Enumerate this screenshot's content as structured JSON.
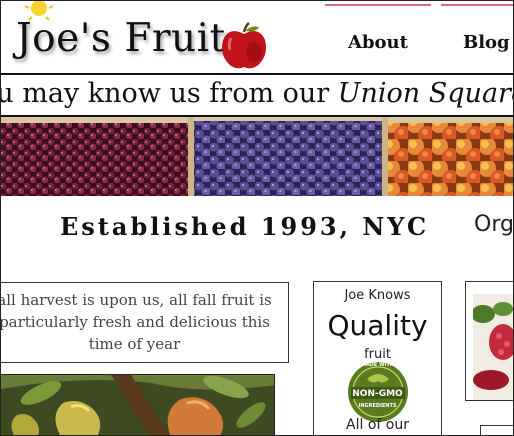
{
  "header": {
    "logo_text": "Joe's Fruit",
    "nav": [
      {
        "label": "About"
      },
      {
        "label": "Blog"
      }
    ]
  },
  "marquee": {
    "text_plain": "ou may know us from our ",
    "text_italic": "Union Square"
  },
  "tagline": {
    "established": "Established 1993, NYC",
    "organic": "Orga"
  },
  "harvest": {
    "lines": [
      "all harvest is upon us, all fall fruit is",
      "particularly fresh and delicious this",
      "time of year"
    ]
  },
  "quality_box": {
    "small_heading": "Joe Knows",
    "big_heading": "Quality",
    "word": "fruit",
    "badge_top": "MADE WITH",
    "badge_main": "NON-GMO",
    "badge_bottom": "INGREDIENTS",
    "bottom_text": "All of our"
  },
  "colors": {
    "nav_accent": "#d46a8c",
    "badge_green": "#5a7a1f",
    "apple_red": "#c2121c"
  }
}
